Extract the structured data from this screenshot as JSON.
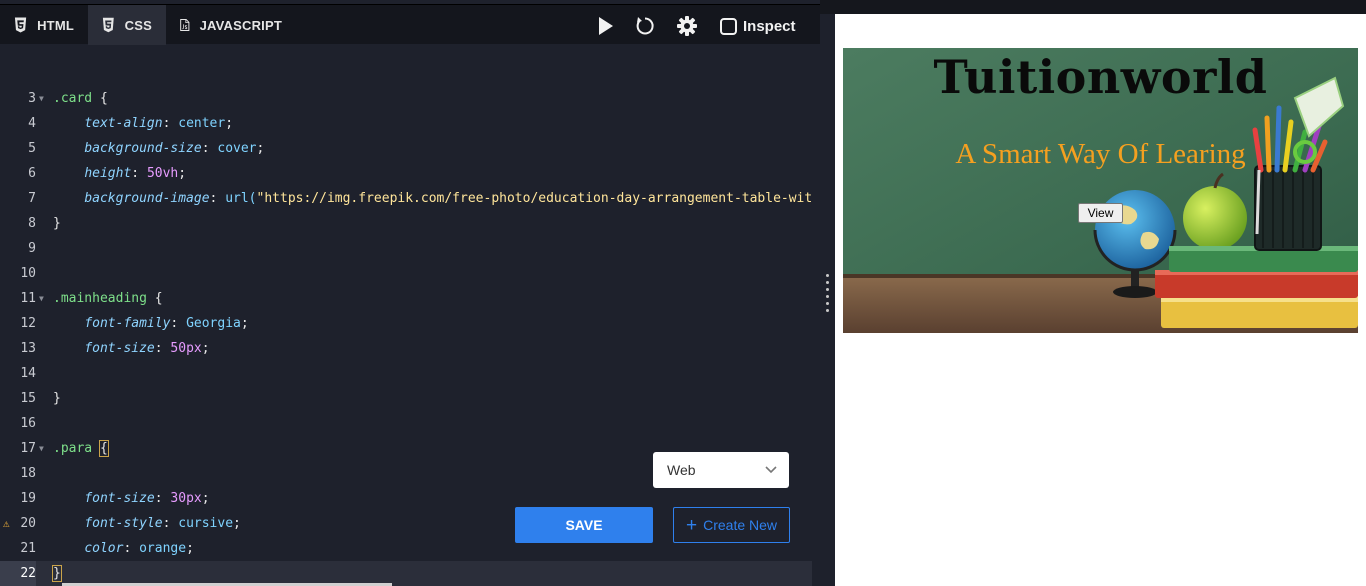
{
  "tabs": [
    {
      "label": "HTML",
      "icon": "html5-icon"
    },
    {
      "label": "CSS",
      "icon": "css3-icon"
    },
    {
      "label": "JAVASCRIPT",
      "icon": "js-file-icon"
    }
  ],
  "toolbar": {
    "run_icon": "play-icon",
    "reset_icon": "reset-icon",
    "settings_icon": "gear-icon",
    "inspect_label": "Inspect"
  },
  "code": {
    "lines": [
      {
        "n": "3",
        "text": ".card {"
      },
      {
        "n": "4",
        "text": "    text-align: center;"
      },
      {
        "n": "5",
        "text": "    background-size: cover;"
      },
      {
        "n": "6",
        "text": "    height: 50vh;"
      },
      {
        "n": "7",
        "text": "    background-image: url(\"https://img.freepik.com/free-photo/education-day-arrangement-table-with"
      },
      {
        "n": "8",
        "text": "}"
      },
      {
        "n": "9",
        "text": ""
      },
      {
        "n": "10",
        "text": ""
      },
      {
        "n": "11",
        "text": ".mainheading {"
      },
      {
        "n": "12",
        "text": "    font-family: Georgia;"
      },
      {
        "n": "13",
        "text": "    font-size: 50px;"
      },
      {
        "n": "14",
        "text": ""
      },
      {
        "n": "15",
        "text": "}"
      },
      {
        "n": "16",
        "text": ""
      },
      {
        "n": "17",
        "text": ".para {"
      },
      {
        "n": "18",
        "text": ""
      },
      {
        "n": "19",
        "text": "    font-size: 30px;"
      },
      {
        "n": "20",
        "text": "    font-style: cursive;"
      },
      {
        "n": "21",
        "text": "    color: orange;"
      },
      {
        "n": "22",
        "text": "}"
      }
    ]
  },
  "device_select": {
    "value": "Web"
  },
  "buttons": {
    "save": "SAVE",
    "create_new": "Create New"
  },
  "preview": {
    "heading": "Tuitionworld",
    "para": "A Smart Way Of Learing",
    "view_button": "View"
  },
  "colors": {
    "accent": "#2f80ed",
    "para_text": "#f5a020",
    "selector": "#7ee08a",
    "property": "#8fd4ff",
    "number": "#e79cff",
    "string": "#ffe59a",
    "warning": "#f2b23a"
  }
}
